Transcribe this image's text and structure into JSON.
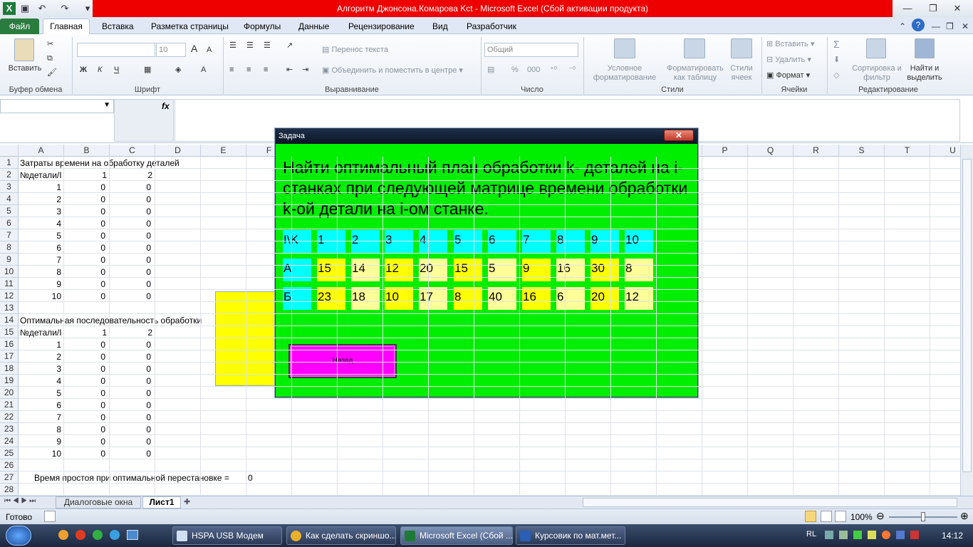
{
  "window": {
    "title": "Алгоритм Джонсона.Комарова Kct  -  Microsoft Excel (Сбой активации продукта)"
  },
  "tabs": [
    "Файл",
    "Главная",
    "Вставка",
    "Разметка страницы",
    "Формулы",
    "Данные",
    "Рецензирование",
    "Вид",
    "Разработчик"
  ],
  "ribbon": {
    "paste": "Вставить",
    "group_clipboard": "Буфер обмена",
    "group_font": "Шрифт",
    "group_align": "Выравнивание",
    "group_number": "Число",
    "group_styles": "Стили",
    "group_cells": "Ячейки",
    "group_edit": "Редактирование",
    "font_size": "10",
    "wrap_text": "Перенос текста",
    "merge_center": "Объединить и поместить в центре",
    "number_format": "Общий",
    "cond_format": "Условное форматирование",
    "format_table": "Форматировать как таблицу",
    "cell_styles": "Стили ячеек",
    "insert": "Вставить",
    "delete": "Удалить",
    "format": "Формат",
    "sort_filter": "Сортировка и фильтр",
    "find_select": "Найти и выделить",
    "bold": "Ж",
    "italic": "К",
    "underline": "Ч",
    "percent": "%",
    "thousands": "000",
    "fx": "fx"
  },
  "columns": [
    "A",
    "B",
    "C",
    "D",
    "E",
    "F",
    "G",
    "H",
    "I",
    "J",
    "K",
    "L",
    "M",
    "N",
    "O",
    "P",
    "Q",
    "R",
    "S",
    "T",
    "U"
  ],
  "rows": [
    "1",
    "2",
    "3",
    "4",
    "5",
    "6",
    "7",
    "8",
    "9",
    "10",
    "11",
    "12",
    "13",
    "14",
    "15",
    "16",
    "17",
    "18",
    "19",
    "20",
    "21",
    "22",
    "23",
    "24",
    "25",
    "26",
    "27",
    "28"
  ],
  "sheet": {
    "title1": "Затраты времени на обработку деталей",
    "hdr_a2": "№детали/I",
    "hdr_b2": "1",
    "hdr_c2": "2",
    "table1": [
      [
        "1",
        "0",
        "0"
      ],
      [
        "2",
        "0",
        "0"
      ],
      [
        "3",
        "0",
        "0"
      ],
      [
        "4",
        "0",
        "0"
      ],
      [
        "5",
        "0",
        "0"
      ],
      [
        "6",
        "0",
        "0"
      ],
      [
        "7",
        "0",
        "0"
      ],
      [
        "8",
        "0",
        "0"
      ],
      [
        "9",
        "0",
        "0"
      ],
      [
        "10",
        "0",
        "0"
      ]
    ],
    "title2": "Оптимальная последовательность обработки",
    "hdr_a15": "№детали/I",
    "hdr_b15": "1",
    "hdr_c15": "2",
    "table2": [
      [
        "1",
        "0",
        "0"
      ],
      [
        "2",
        "0",
        "0"
      ],
      [
        "3",
        "0",
        "0"
      ],
      [
        "4",
        "0",
        "0"
      ],
      [
        "5",
        "0",
        "0"
      ],
      [
        "6",
        "0",
        "0"
      ],
      [
        "7",
        "0",
        "0"
      ],
      [
        "8",
        "0",
        "0"
      ],
      [
        "9",
        "0",
        "0"
      ],
      [
        "10",
        "0",
        "0"
      ]
    ],
    "idle_label": "Время простоя при оптимальной перестановке =",
    "idle_value": "0"
  },
  "sheet_tabs": [
    "Диалоговые окна",
    "Лист1"
  ],
  "status": {
    "ready": "Готово",
    "zoom": "100%"
  },
  "dialog": {
    "title": "Задача",
    "close": "✕",
    "text": "Найти оптимальный план обработки k- деталей на i-станках при следующей матрице времени обработки k-ой детали на i-ом станке.",
    "header": [
      "I\\K",
      "1",
      "2",
      "3",
      "4",
      "5",
      "6",
      "7",
      "8",
      "9",
      "10"
    ],
    "row_a": [
      "А",
      "15",
      "14",
      "12",
      "20",
      "15",
      "5",
      "9",
      "16",
      "30",
      "8"
    ],
    "row_b": [
      "Б",
      "23",
      "18",
      "10",
      "17",
      "8",
      "40",
      "16",
      "6",
      "20",
      "12"
    ],
    "back": "Назад",
    "colors": {
      "bg": "#00ee00",
      "cyan": "#00ffff",
      "yellow": "#ffff00",
      "pale": "#ffff99",
      "button": "#ff00ff"
    }
  },
  "taskbar": {
    "items": [
      "HSPA USB Модем",
      "Как сделать скриншо...",
      "Microsoft Excel (Сбой ...",
      "Курсовик по мат.мет..."
    ],
    "lang": "RL",
    "time": "14:12"
  }
}
